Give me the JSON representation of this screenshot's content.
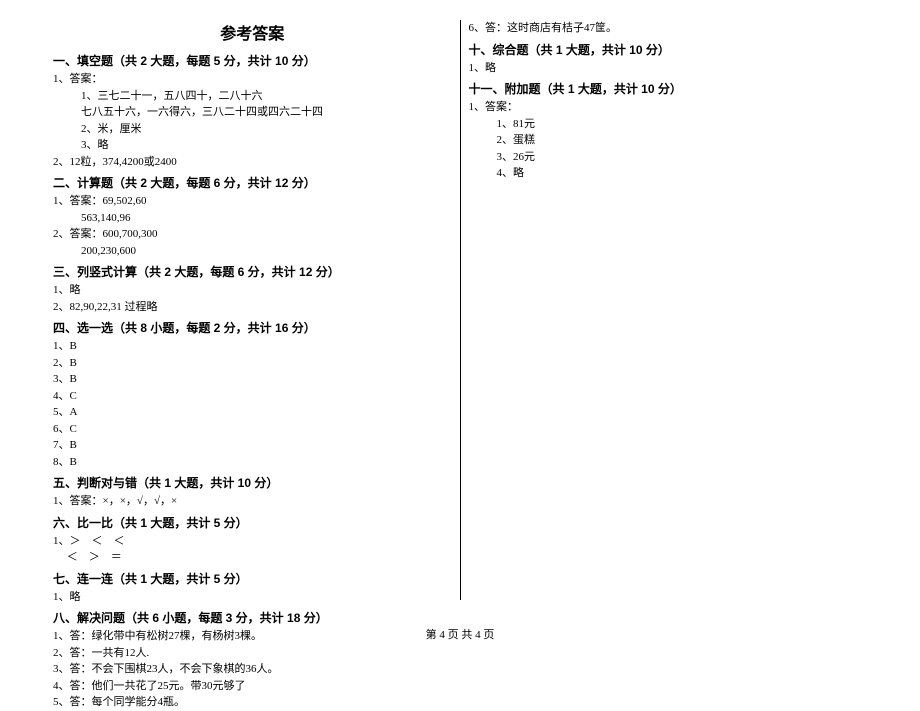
{
  "title": "参考答案",
  "left": {
    "s1": {
      "header": "一、填空题（共 2 大题，每题 5 分，共计 10 分）",
      "q1": "1、答案：",
      "q1_1": "1、三七二十一，五八四十，二八十六",
      "q1_2": "七八五十六，一六得六，三八二十四或四六二十四",
      "q1_3": "2、米，厘米",
      "q1_4": "3、略",
      "q2": "2、12粒，374,4200或2400"
    },
    "s2": {
      "header": "二、计算题（共 2 大题，每题 6 分，共计 12 分）",
      "q1": "1、答案：69,502,60",
      "q1_1": "563,140,96",
      "q2": "2、答案：600,700,300",
      "q2_1": "200,230,600"
    },
    "s3": {
      "header": "三、列竖式计算（共 2 大题，每题 6 分，共计 12 分）",
      "q1": "1、略",
      "q2": "2、82,90,22,31 过程略"
    },
    "s4": {
      "header": "四、选一选（共 8 小题，每题 2 分，共计 16 分）",
      "q1": "1、B",
      "q2": "2、B",
      "q3": "3、B",
      "q4": "4、C",
      "q5": "5、A",
      "q6": "6、C",
      "q7": "7、B",
      "q8": "8、B"
    },
    "s5": {
      "header": "五、判断对与错（共 1 大题，共计 10 分）",
      "q1": "1、答案：×，×，√，√，×"
    },
    "s6": {
      "header": "六、比一比（共 1 大题，共计 5 分）",
      "q1": "1、＞　＜　＜",
      "q1_1": "　 ＜　＞　＝"
    },
    "s7": {
      "header": "七、连一连（共 1 大题，共计 5 分）",
      "q1": "1、略"
    },
    "s8": {
      "header": "八、解决问题（共 6 小题，每题 3 分，共计 18 分）",
      "q1": "1、答：绿化带中有松树27棵，有杨树3棵。",
      "q2": "2、答：一共有12人.",
      "q3": "3、答：不会下围棋23人，不会下象棋的36人。",
      "q4": "4、答：他们一共花了25元。带30元够了",
      "q5": "5、答：每个同学能分4瓶。"
    }
  },
  "right": {
    "pre": "6、答：这时商店有桔子47筐。",
    "s10": {
      "header": "十、综合题（共 1 大题，共计 10 分）",
      "q1": "1、略"
    },
    "s11": {
      "header": "十一、附加题（共 1 大题，共计 10 分）",
      "q1": "1、答案：",
      "q1_1": "1、81元",
      "q1_2": "2、蛋糕",
      "q1_3": "3、26元",
      "q1_4": "4、略"
    }
  },
  "footer": "第 4 页 共 4 页"
}
